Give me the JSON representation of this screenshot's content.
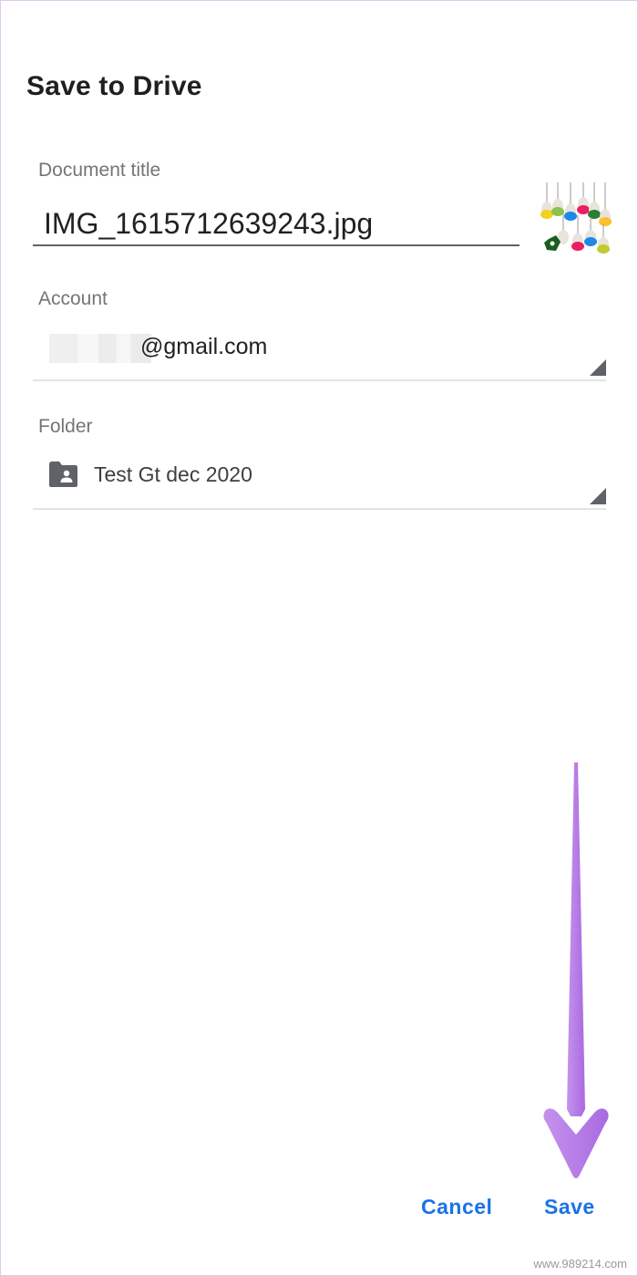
{
  "dialog": {
    "title": "Save to Drive"
  },
  "document_title": {
    "label": "Document title",
    "value": "IMG_1615712639243.jpg"
  },
  "account": {
    "label": "Account",
    "value": "@gmail.com"
  },
  "folder": {
    "label": "Folder",
    "value": "Test Gt dec 2020",
    "icon": "shared-folder-icon"
  },
  "actions": {
    "cancel_label": "Cancel",
    "save_label": "Save"
  },
  "watermark": "www.989214.com",
  "colors": {
    "accent": "#1a73e8",
    "annotation_arrow": "#b97ee8"
  }
}
